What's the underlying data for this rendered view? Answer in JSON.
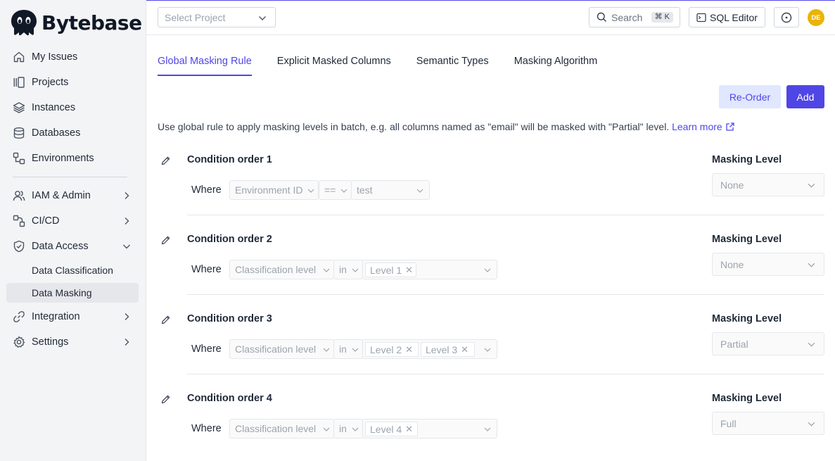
{
  "brand": {
    "name": "Bytebase"
  },
  "sidebar": {
    "items": [
      {
        "label": "My Issues",
        "icon": "home-icon"
      },
      {
        "label": "Projects",
        "icon": "projects-icon"
      },
      {
        "label": "Instances",
        "icon": "layers-icon"
      },
      {
        "label": "Databases",
        "icon": "database-icon"
      },
      {
        "label": "Environments",
        "icon": "environments-icon"
      },
      {
        "label": "IAM & Admin",
        "icon": "users-icon"
      },
      {
        "label": "CI/CD",
        "icon": "workflow-icon"
      },
      {
        "label": "Data Access",
        "icon": "shield-icon"
      },
      {
        "label": "Integration",
        "icon": "link-icon"
      },
      {
        "label": "Settings",
        "icon": "gear-icon"
      }
    ],
    "sub_items": [
      {
        "label": "Data Classification"
      },
      {
        "label": "Data Masking",
        "active": true
      }
    ]
  },
  "header": {
    "project_placeholder": "Select Project",
    "search_label": "Search",
    "search_shortcut": "⌘ K",
    "sql_editor_label": "SQL Editor",
    "avatar_initials": "DE",
    "avatar_color": "#eab308"
  },
  "tabs": [
    {
      "label": "Global Masking Rule",
      "active": true
    },
    {
      "label": "Explicit Masked Columns"
    },
    {
      "label": "Semantic Types"
    },
    {
      "label": "Masking Algorithm"
    }
  ],
  "actions": {
    "reorder_label": "Re-Order",
    "add_label": "Add"
  },
  "description": {
    "text": "Use global rule to apply masking levels in batch, e.g. all columns named as \"email\" will be masked with \"Partial\" level.",
    "link_label": "Learn more"
  },
  "rules": [
    {
      "title": "Condition order 1",
      "where_label": "Where",
      "factor": "Environment ID",
      "operator": "==",
      "value": "test",
      "masking_level_label": "Masking Level",
      "masking_level": "None"
    },
    {
      "title": "Condition order 2",
      "where_label": "Where",
      "factor": "Classification level",
      "operator": "in",
      "tags": [
        "Level 1"
      ],
      "masking_level_label": "Masking Level",
      "masking_level": "None"
    },
    {
      "title": "Condition order 3",
      "where_label": "Where",
      "factor": "Classification level",
      "operator": "in",
      "tags": [
        "Level 2",
        "Level 3"
      ],
      "masking_level_label": "Masking Level",
      "masking_level": "Partial"
    },
    {
      "title": "Condition order 4",
      "where_label": "Where",
      "factor": "Classification level",
      "operator": "in",
      "tags": [
        "Level 4"
      ],
      "masking_level_label": "Masking Level",
      "masking_level": "Full"
    }
  ],
  "colors": {
    "accent": "#4f46e5",
    "accent_light": "#e0e7ff"
  }
}
